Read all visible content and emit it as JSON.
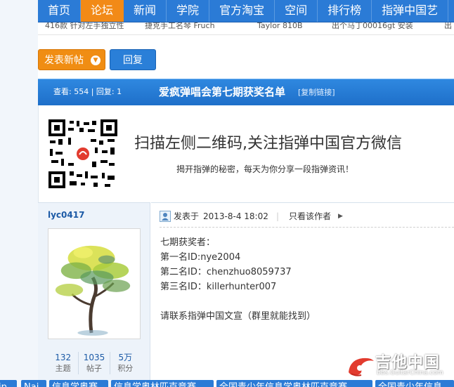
{
  "nav": {
    "items": [
      "首页",
      "论坛",
      "新闻",
      "学院",
      "官方淘宝",
      "空间",
      "排行榜",
      "指弹中国艺"
    ],
    "active_index": 1,
    "colors": {
      "bar": "#2b7bd6",
      "active": "#f28a17"
    }
  },
  "strip": {
    "items": [
      "416款 针对左手独立性",
      "捷克手工名琴 Fruch",
      "Taylor 810B",
      "出个马丁00016gt 安装",
      "出"
    ]
  },
  "actions": {
    "new_post": "发表新帖",
    "new_post_arrow_icon": "chevron-down-icon",
    "reply": "回复"
  },
  "thread": {
    "stats": "查看: 554 | 回复: 1",
    "title": "爱疯弹唱会第七期获奖名单",
    "copy_link": "[复制链接]"
  },
  "banner": {
    "title": "扫描左侧二维码,关注指弹中国官方微信",
    "subtitle": "揭开指弹的秘密，每天为你分享一段指弹资讯！",
    "qr_icon": "qr-code-icon"
  },
  "author": {
    "name": "lyc0417",
    "stats": [
      {
        "value": "132",
        "label": "主题"
      },
      {
        "value": "1035",
        "label": "帖子"
      },
      {
        "value": "5万",
        "label": "积分"
      }
    ]
  },
  "post": {
    "posted_label": "发表于",
    "posted_date": "2013-8-4 18:02",
    "separator": "|",
    "author_only": "只看该作者",
    "body": [
      "七期获奖者：",
      "第一名ID:nye2004",
      "第二名ID：chenzhuo8059737",
      "第三名ID：killerhunter007",
      "请联系指弹中国文宣（群里就能找到）"
    ]
  },
  "watermark": {
    "text": "吉他中国",
    "url": "bbs.GuitarChina.com"
  },
  "bottom_tags": [
    "ip",
    "Nai",
    "信息学奥赛",
    "信息学奥林匹克竞赛",
    "全国青少年信息学奥林匹克竞赛",
    "全国青少年信息"
  ]
}
